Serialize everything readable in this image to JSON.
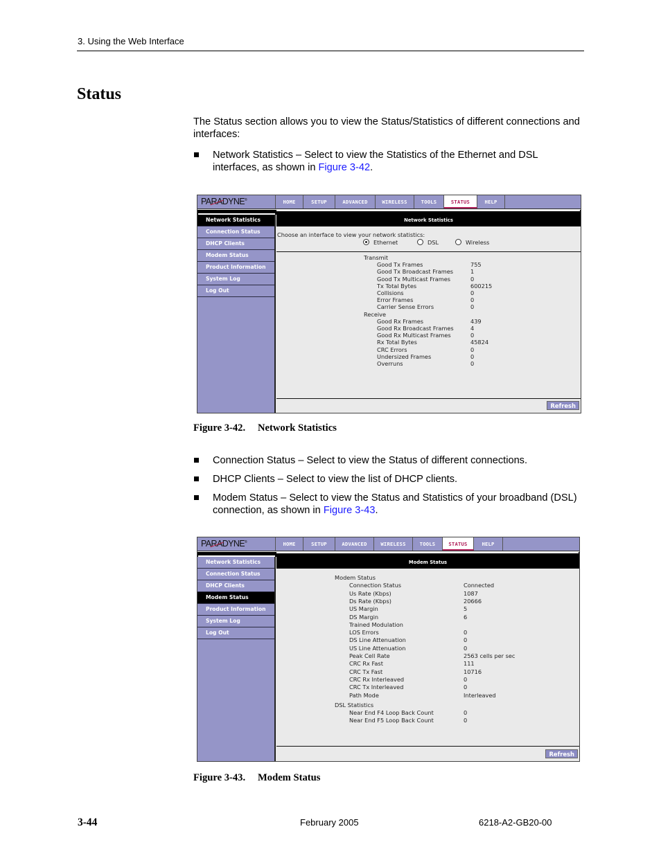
{
  "page": {
    "running_header": "3. Using the Web Interface",
    "section_title": "Status",
    "intro": "The Status section allows you to view the Status/Statistics of different connections and interfaces:",
    "bullets": [
      {
        "text": "Network Statistics – Select to view the Statistics of the Ethernet and DSL interfaces, as shown in ",
        "link": "Figure 3-42",
        "after": "."
      },
      {
        "text": "Connection Status – Select to view the Status of different connections.",
        "link": "",
        "after": ""
      },
      {
        "text": "DHCP Clients – Select to view the list of DHCP clients.",
        "link": "",
        "after": ""
      },
      {
        "text": "Modem Status – Select to view the Status and Statistics of your broadband (DSL) connection, as shown in ",
        "link": "Figure 3-43",
        "after": "."
      }
    ],
    "figures": [
      {
        "number": "Figure 3-42.",
        "title": "Network Statistics"
      },
      {
        "number": "Figure 3-43.",
        "title": "Modem Status"
      }
    ],
    "footer": {
      "page_number": "3-44",
      "date": "February 2005",
      "doc_id": "6218-A2-GB20-00"
    },
    "link_color": "#1a1aff"
  },
  "router_ui": {
    "logo": "PARADYNE",
    "nav_tabs": [
      "HOME",
      "SETUP",
      "ADVANCED",
      "WIRELESS",
      "TOOLS",
      "STATUS",
      "HELP"
    ],
    "active_tab": "STATUS",
    "sidebar_items": [
      "Network Statistics",
      "Connection Status",
      "DHCP Clients",
      "Modem Status",
      "Product Information",
      "System Log",
      "Log Out"
    ],
    "refresh_label": "Refresh",
    "colors": {
      "nav_bg": "#9595c8",
      "active_tab_text": "#b0205a",
      "content_bg": "#eaeaea"
    }
  },
  "network_stats": {
    "panel_title": "Network Statistics",
    "active_sidebar": "Network Statistics",
    "prompt": "Choose an interface to view your network statistics:",
    "interfaces": [
      {
        "label": "Ethernet",
        "selected": true
      },
      {
        "label": "DSL",
        "selected": false
      },
      {
        "label": "Wireless",
        "selected": false
      }
    ],
    "transmit_heading": "Transmit",
    "transmit": [
      {
        "label": "Good Tx Frames",
        "value": "755"
      },
      {
        "label": "Good Tx Broadcast Frames",
        "value": "1"
      },
      {
        "label": "Good Tx Multicast Frames",
        "value": "0"
      },
      {
        "label": "Tx Total Bytes",
        "value": "600215"
      },
      {
        "label": "Collisions",
        "value": "0"
      },
      {
        "label": "Error Frames",
        "value": "0"
      },
      {
        "label": "Carrier Sense Errors",
        "value": "0"
      }
    ],
    "receive_heading": "Receive",
    "receive": [
      {
        "label": "Good Rx Frames",
        "value": "439"
      },
      {
        "label": "Good Rx Broadcast Frames",
        "value": "4"
      },
      {
        "label": "Good Rx Multicast Frames",
        "value": "0"
      },
      {
        "label": "Rx Total Bytes",
        "value": "45824"
      },
      {
        "label": "CRC Errors",
        "value": "0"
      },
      {
        "label": "Undersized Frames",
        "value": "0"
      },
      {
        "label": "Overruns",
        "value": "0"
      }
    ]
  },
  "modem_status": {
    "panel_title": "Modem Status",
    "active_sidebar": "Modem Status",
    "status_heading": "Modem Status",
    "status": [
      {
        "label": "Connection Status",
        "value": "Connected"
      },
      {
        "label": "Us Rate (Kbps)",
        "value": "1087"
      },
      {
        "label": "Ds Rate (Kbps)",
        "value": "20666"
      },
      {
        "label": "US Margin",
        "value": "5"
      },
      {
        "label": "DS Margin",
        "value": "6"
      },
      {
        "label": "Trained Modulation",
        "value": ""
      },
      {
        "label": "LOS Errors",
        "value": "0"
      },
      {
        "label": "DS Line Attenuation",
        "value": "0"
      },
      {
        "label": "US Line Attenuation",
        "value": "0"
      },
      {
        "label": "Peak Cell Rate",
        "value": "2563 cells per sec"
      },
      {
        "label": "CRC Rx Fast",
        "value": "111"
      },
      {
        "label": "CRC Tx Fast",
        "value": "10716"
      },
      {
        "label": "CRC Rx Interleaved",
        "value": "0"
      },
      {
        "label": "CRC Tx Interleaved",
        "value": "0"
      },
      {
        "label": "Path Mode",
        "value": "Interleaved"
      }
    ],
    "dsl_heading": "DSL Statistics",
    "dsl": [
      {
        "label": "Near End F4 Loop Back Count",
        "value": "0"
      },
      {
        "label": "Near End F5 Loop Back Count",
        "value": "0"
      }
    ]
  }
}
